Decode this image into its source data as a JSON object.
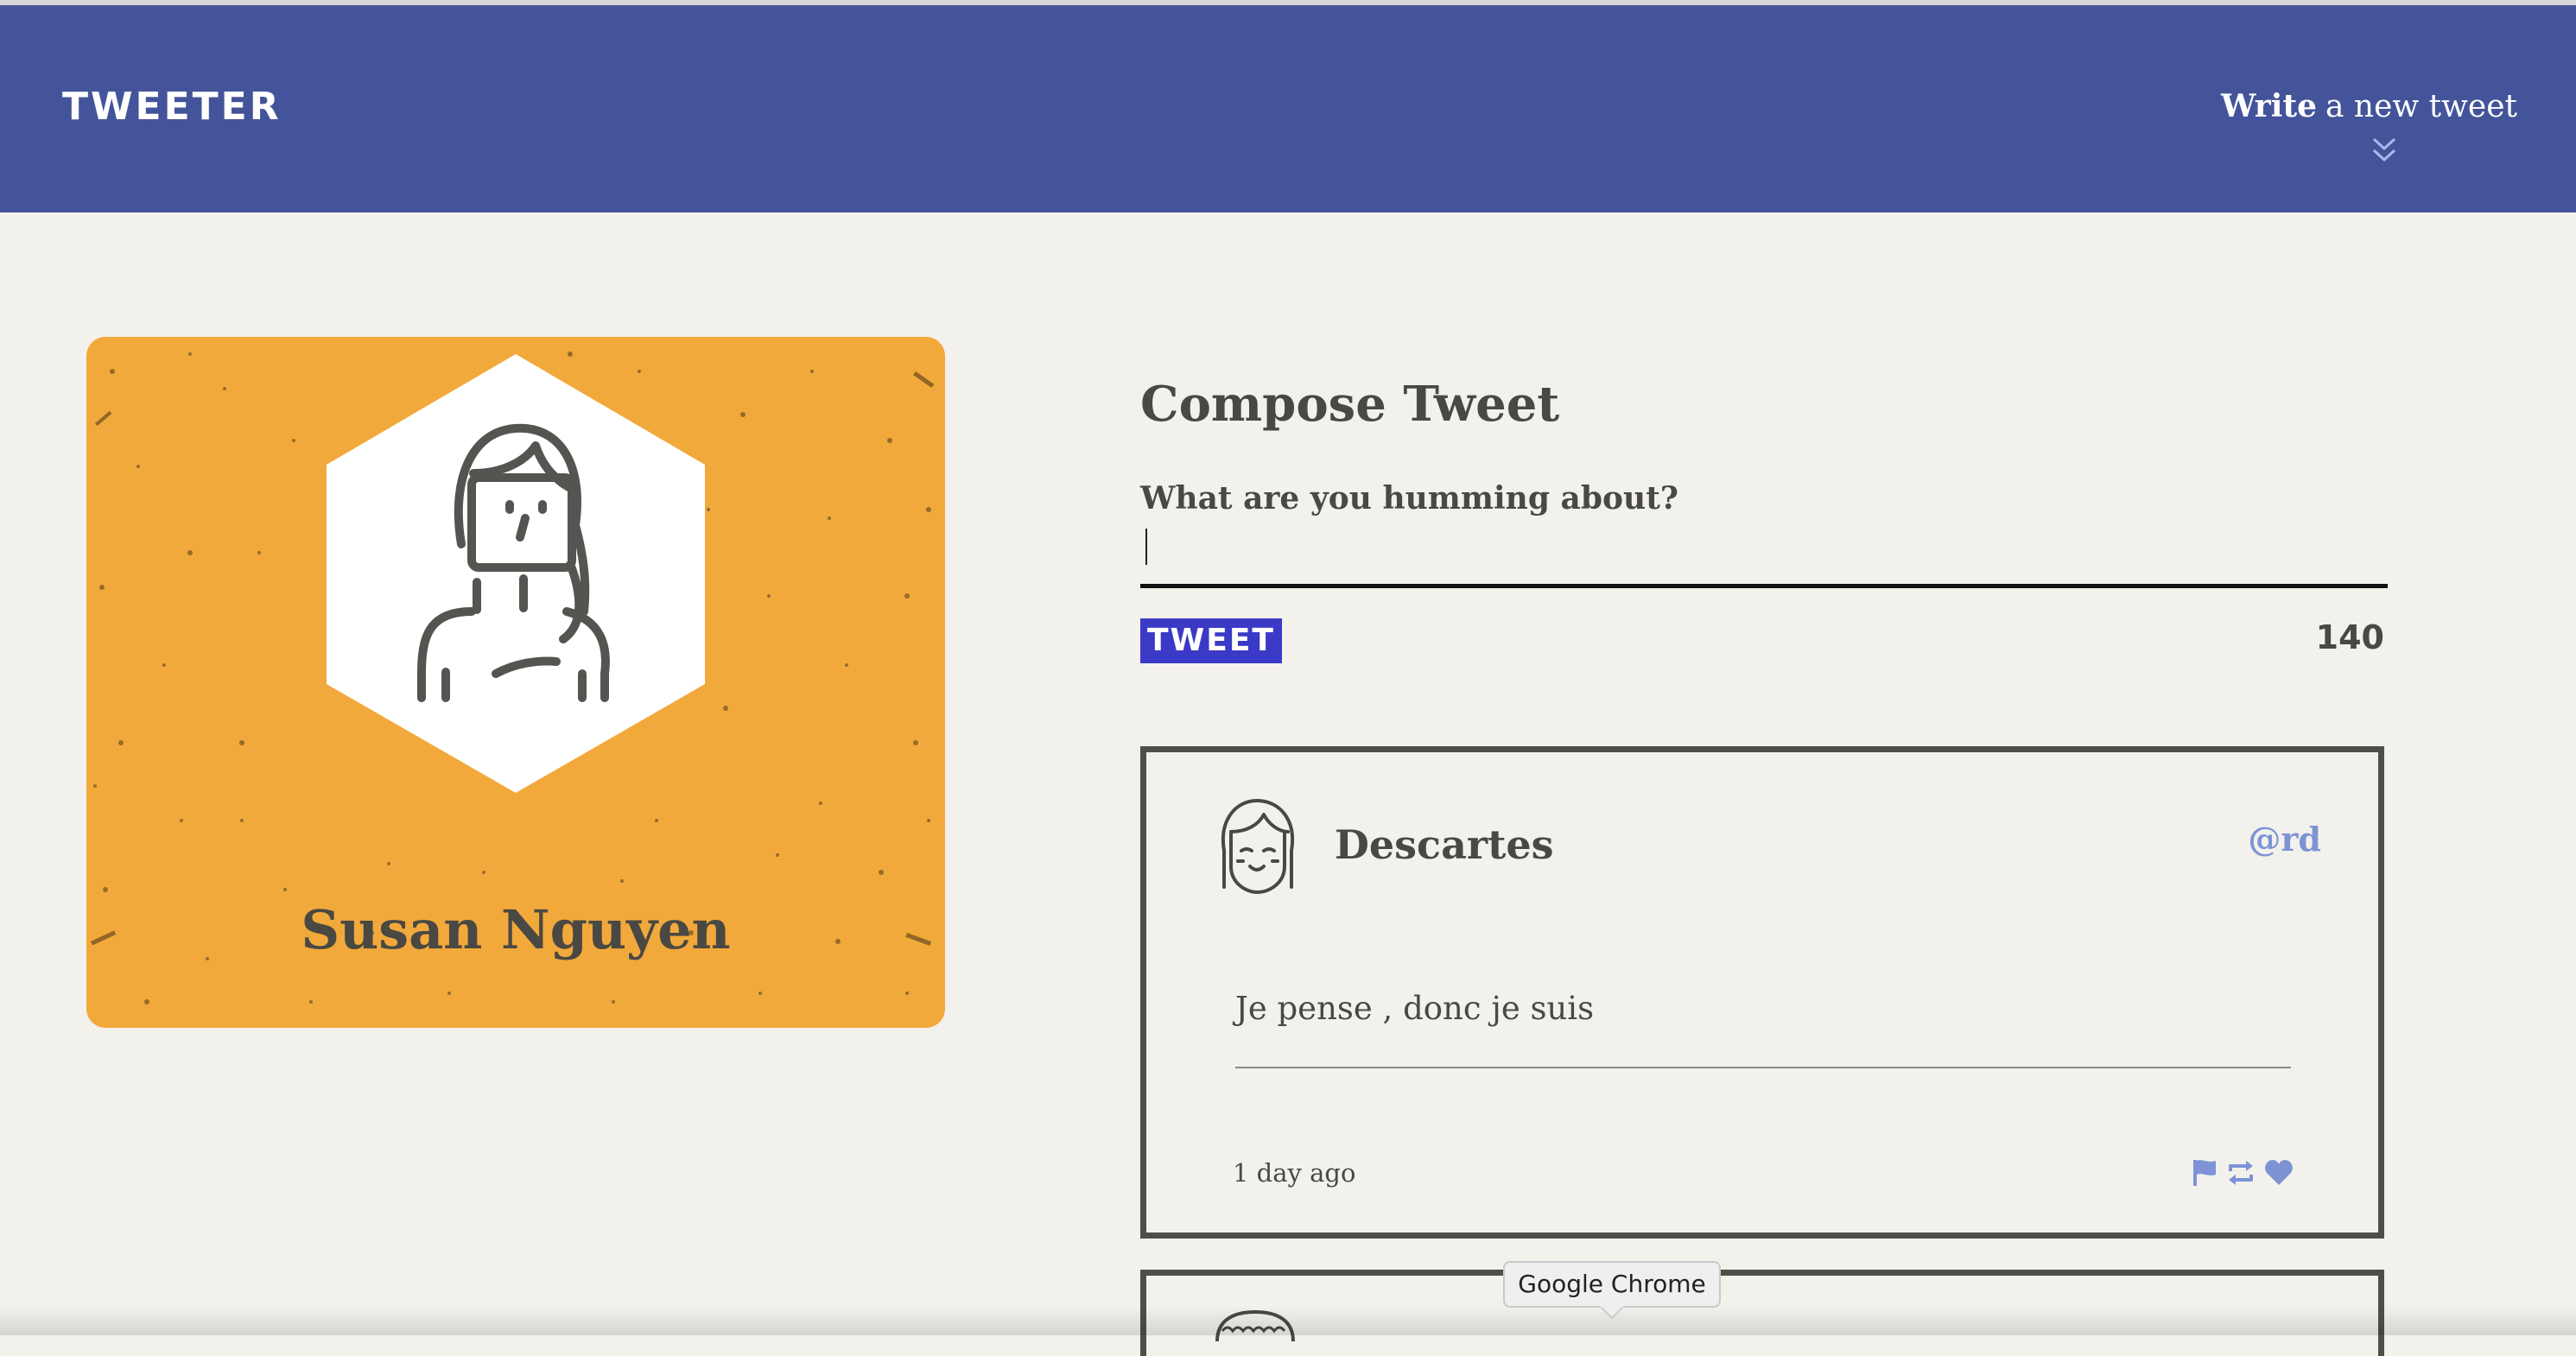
{
  "nav": {
    "brand": "TWEETER",
    "write_bold": "Write",
    "write_rest": "a new tweet",
    "icons": [
      "double-chevron-down-icon"
    ]
  },
  "profile": {
    "name": "Susan Nguyen",
    "background_color": "#f2a93b",
    "icon": "user-avatar-icon"
  },
  "compose": {
    "title": "Compose Tweet",
    "label": "What are you humming about?",
    "input_value": "",
    "button_label": "TWEET",
    "counter": "140"
  },
  "tweets": [
    {
      "author": "Descartes",
      "handle": "@rd",
      "text": "Je pense , donc je suis",
      "time": "1 day ago",
      "avatar_icon": "smiling-girl-avatar-icon",
      "actions": [
        "flag-icon",
        "retweet-icon",
        "heart-icon"
      ]
    }
  ],
  "tooltip": {
    "text": "Google Chrome"
  },
  "colors": {
    "nav": "#44549a",
    "page": "#f3f1ec",
    "accent": "#3b3ac6",
    "handle": "#7d93d6",
    "text": "#4a4843"
  }
}
